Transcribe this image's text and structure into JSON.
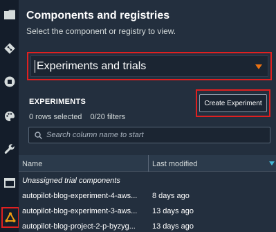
{
  "panel": {
    "title": "Components and registries",
    "subtitle": "Select the component or registry to view."
  },
  "selector": {
    "value": "Experiments and trials"
  },
  "experiments": {
    "heading": "EXPERIMENTS",
    "rows_selected": "0 rows selected",
    "filters": "0/20 filters",
    "create_label": "Create Experiment",
    "search_placeholder": "Search column name to start"
  },
  "table": {
    "columns": [
      "Name",
      "Last modified"
    ],
    "group_label": "Unassigned trial components",
    "rows": [
      {
        "name": "autopilot-blog-experiment-4-aws...",
        "modified": "8 days ago"
      },
      {
        "name": "autopilot-blog-experiment-3-aws...",
        "modified": "13 days ago"
      },
      {
        "name": "autopilot-blog-project-2-p-byzyg...",
        "modified": "13 days ago"
      }
    ]
  },
  "rail_icons": [
    "folder-icon",
    "git-icon",
    "stop-circle-icon",
    "palette-icon",
    "wrench-icon",
    "window-icon",
    "components-registries-icon"
  ],
  "colors": {
    "accent_orange": "#ec7211",
    "highlight_red": "#e02020",
    "sort_blue": "#44b9d6",
    "background": "#232f3e",
    "rail": "#141d2a"
  }
}
